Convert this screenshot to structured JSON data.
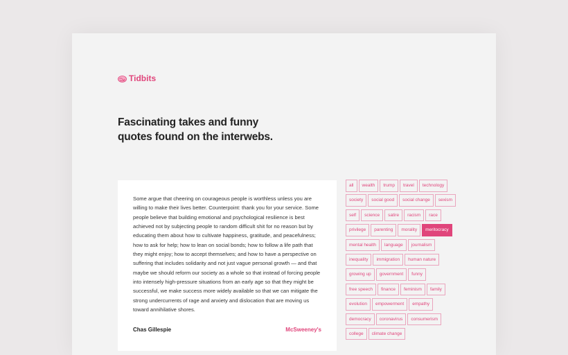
{
  "brand": {
    "name": "Tidbits",
    "icon": "brain-icon",
    "accent": "#e0457b"
  },
  "hero": {
    "line1": "Fascinating takes and funny",
    "line2": "quotes found on the interwebs."
  },
  "quote": {
    "text": "Some argue that cheering on courageous people is worthless unless you are willing to make their lives better. Counterpoint: thank you for your service. Some people believe that building emotional and psychological resilience is best achieved not by subjecting people to random difficult shit for no reason but by educating them about how to cultivate happiness, gratitude, and peacefulness; how to ask for help; how to lean on social bonds; how to follow a life path that they might enjoy; how to accept themselves; and how to have a perspective on suffering that includes solidarity and not just vague personal growth — and that maybe we should reform our society as a whole so that instead of forcing people into intensely high-pressure situations from an early age so that they might be successful, we make success more widely available so that we can mitigate the strong undercurrents of rage and anxiety and dislocation that are moving us toward annihilative shores.",
    "author": "Chas Gillespie",
    "source": "McSweeney's"
  },
  "tags": [
    "all",
    "wealth",
    "trump",
    "travel",
    "technology",
    "society",
    "social good",
    "social change",
    "sexism",
    "self",
    "science",
    "satire",
    "racism",
    "race",
    "privilege",
    "parenting",
    "morality",
    "meritocracy",
    "mental health",
    "language",
    "journalism",
    "inequality",
    "immigration",
    "human nature",
    "growing up",
    "government",
    "funny",
    "free speech",
    "finance",
    "feminism",
    "family",
    "evolution",
    "empowerment",
    "empathy",
    "democracy",
    "coronavirus",
    "consumerism",
    "college",
    "climate change"
  ],
  "active_tag": "meritocracy"
}
